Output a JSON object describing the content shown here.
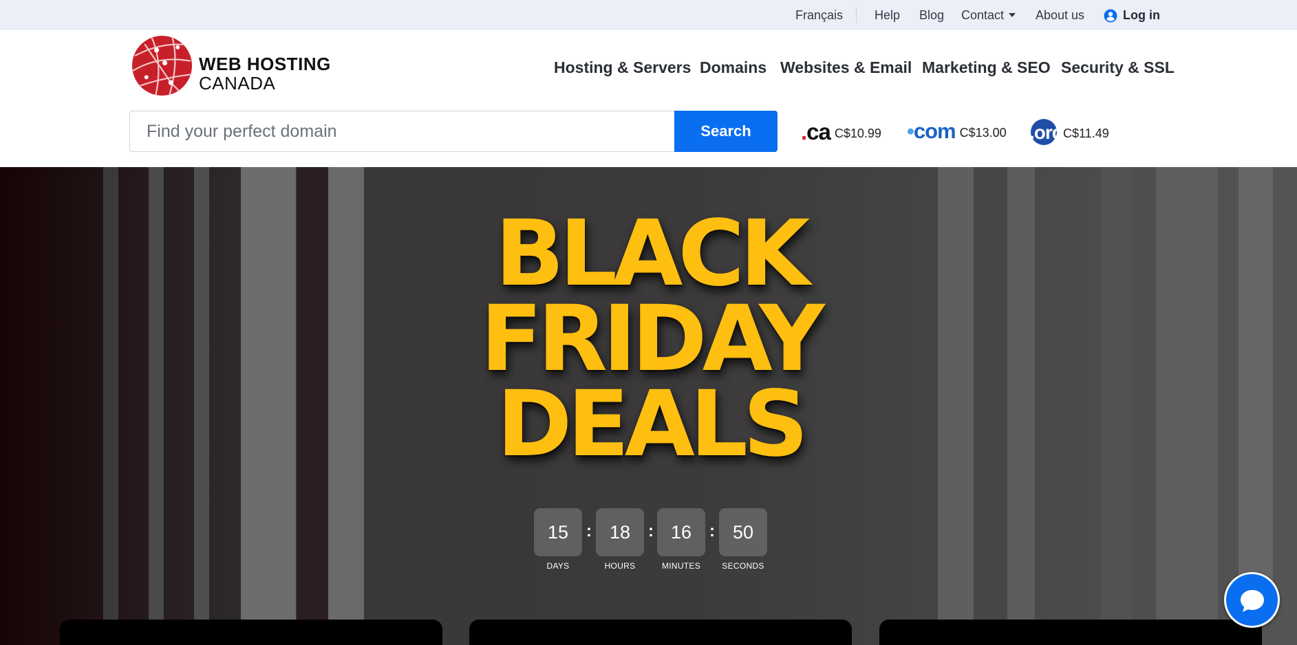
{
  "utility_nav": {
    "language": "Français",
    "help": "Help",
    "blog": "Blog",
    "contact": "Contact",
    "about": "About us",
    "login": "Log in"
  },
  "logo": {
    "line1": "WEB HOSTING",
    "line2": "CANADA"
  },
  "main_nav": [
    {
      "label": "Hosting & Servers"
    },
    {
      "label": "Domains"
    },
    {
      "label": "Websites & Email"
    },
    {
      "label": "Marketing & SEO"
    },
    {
      "label": "Security & SSL"
    }
  ],
  "domain_search": {
    "placeholder": "Find your perfect domain",
    "button_label": "Search"
  },
  "tld_prices": [
    {
      "tld": ".ca",
      "price": "C$10.99"
    },
    {
      "tld": ".com",
      "price": "C$13.00"
    },
    {
      "tld": ".org",
      "price": "C$11.49"
    }
  ],
  "hero": {
    "headline_lines": [
      "BLACK",
      "FRIDAY",
      "DEALS"
    ],
    "countdown": [
      {
        "value": "15",
        "label": "DAYS"
      },
      {
        "value": "18",
        "label": "HOURS"
      },
      {
        "value": "16",
        "label": "MINUTES"
      },
      {
        "value": "50",
        "label": "SECONDS"
      }
    ],
    "separator": ":"
  },
  "chat": {
    "icon": "chat-bubble-icon"
  },
  "colors": {
    "accent_blue": "#0a6ef0",
    "headline_yellow": "#ffbf10",
    "logo_red": "#c8202a",
    "utility_bar_bg": "#eceff7"
  }
}
